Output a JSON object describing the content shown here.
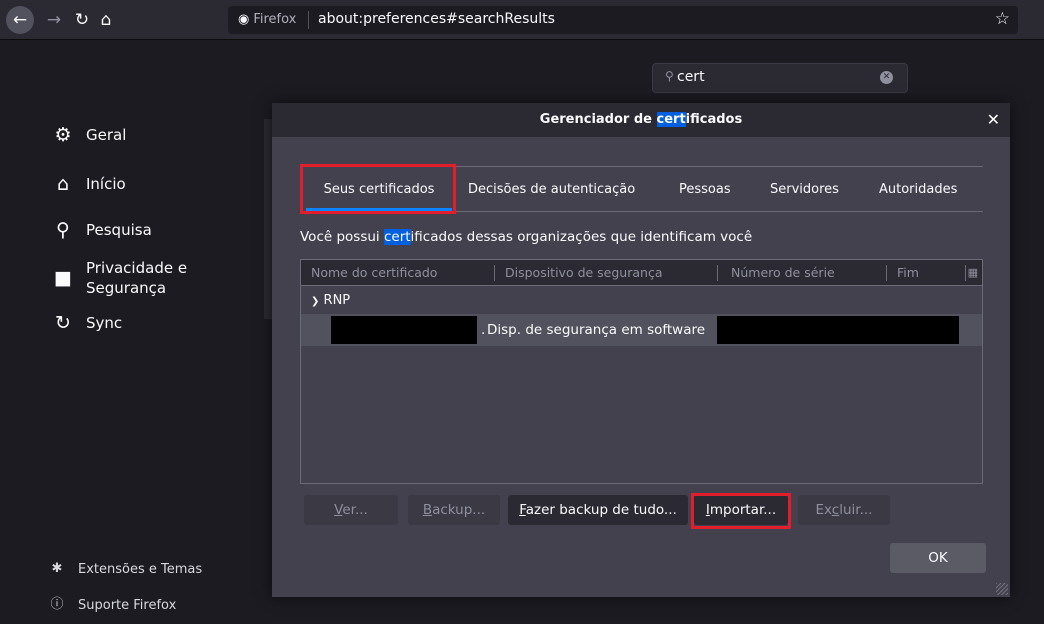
{
  "browser": {
    "identity": "Firefox",
    "url": "about:preferences#searchResults"
  },
  "prefs": {
    "search_value": "cert",
    "sidebar": [
      {
        "label": "Geral",
        "icon": "gear-icon"
      },
      {
        "label": "Início",
        "icon": "home-icon"
      },
      {
        "label": "Pesquisa",
        "icon": "search-icon"
      },
      {
        "label": "Privacidade e",
        "label2": "Segurança",
        "icon": "lock-icon"
      },
      {
        "label": "Sync",
        "icon": "sync-icon"
      }
    ],
    "bottom_links": [
      {
        "label": "Extensões e Temas",
        "icon": "puzzle-icon"
      },
      {
        "label": "Suporte Firefox",
        "icon": "help-icon"
      }
    ]
  },
  "dialog": {
    "title_before": "Gerenciador de ",
    "title_highlight": "cert",
    "title_after": "ificados",
    "tabs": [
      "Seus certificados",
      "Decisões de autenticação",
      "Pessoas",
      "Servidores",
      "Autoridades"
    ],
    "desc_before": "Você possui ",
    "desc_highlight": "cert",
    "desc_after": "ificados dessas organizações que identificam você",
    "columns": [
      "Nome do certificado",
      "Dispositivo de segurança",
      "Número de série",
      "Fim"
    ],
    "group": "RNP",
    "row_device": "Disp. de segurança em software",
    "buttons": {
      "view_mn": "V",
      "view_rest": "er...",
      "backup_mn": "B",
      "backup_rest": "ackup...",
      "backup_all_mn": "F",
      "backup_all_rest": "azer backup de tudo...",
      "import_mn": "I",
      "import_rest": "mportar...",
      "delete_pre": "Ex",
      "delete_mn": "c",
      "delete_rest": "luir..."
    },
    "ok": "OK"
  },
  "colors": {
    "highlight_box": "#e21e2c",
    "accent": "#0a84ff"
  }
}
